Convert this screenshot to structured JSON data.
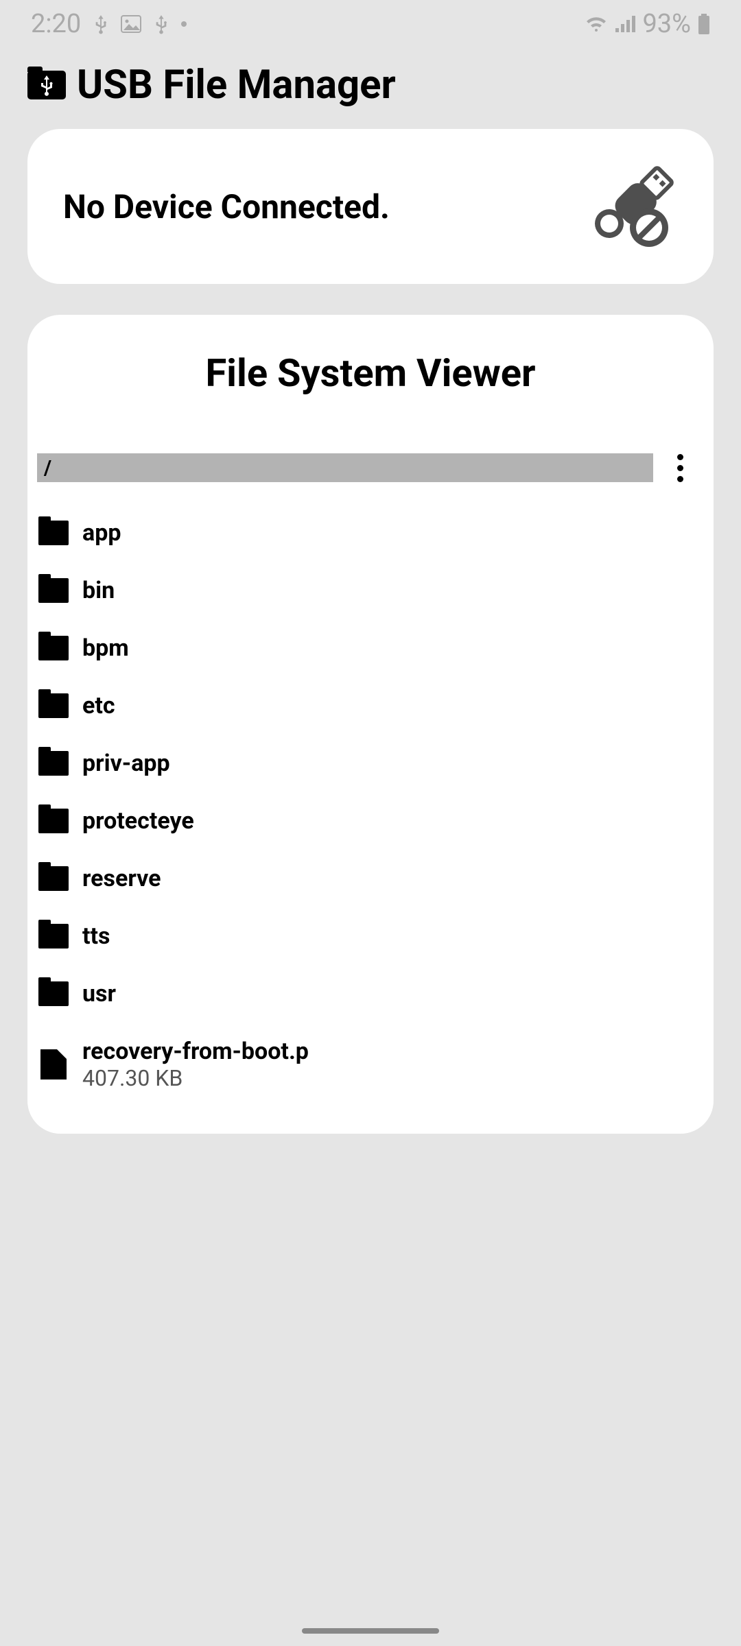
{
  "status": {
    "time": "2:20",
    "battery": "93%"
  },
  "app": {
    "title": "USB File Manager"
  },
  "device_card": {
    "message": "No Device Connected."
  },
  "fs": {
    "title": "File System Viewer",
    "path": "/",
    "items": [
      {
        "type": "folder",
        "name": "app"
      },
      {
        "type": "folder",
        "name": "bin"
      },
      {
        "type": "folder",
        "name": "bpm"
      },
      {
        "type": "folder",
        "name": "etc"
      },
      {
        "type": "folder",
        "name": "priv-app"
      },
      {
        "type": "folder",
        "name": "protecteye"
      },
      {
        "type": "folder",
        "name": "reserve"
      },
      {
        "type": "folder",
        "name": "tts"
      },
      {
        "type": "folder",
        "name": "usr"
      },
      {
        "type": "file",
        "name": "recovery-from-boot.p",
        "size": "407.30 KB"
      }
    ]
  }
}
